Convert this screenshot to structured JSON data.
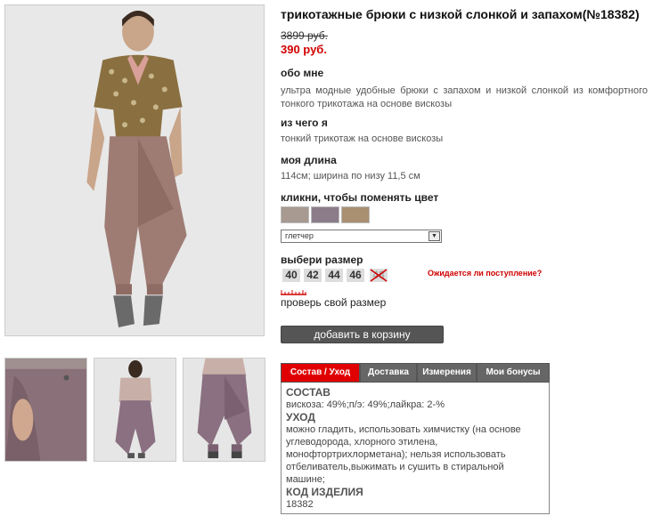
{
  "product": {
    "title": "трикотажные брюки с низкой слонкой и запахом(№18382)",
    "old_price": "3899 руб.",
    "new_price": "390 руб."
  },
  "sections": {
    "about_heading": "обо мне",
    "about_text": "ультра модные удобные брюки с запахом и низкой слонкой из комфортного тонкого трикотажа на основе вискозы",
    "material_heading": "из чего я",
    "material_text": "тонкий трикотаж на основе вискозы",
    "length_heading": "моя длина",
    "length_text": "114см; ширина по низу 11,5 см",
    "color_heading": "кликни, чтобы поменять цвет",
    "size_heading": "выбери размер"
  },
  "colors": {
    "swatches": [
      "#a89a90",
      "#8c7c8a",
      "#a89070"
    ],
    "selected": "глетчер"
  },
  "sizes": {
    "list": [
      "40",
      "42",
      "44",
      "46",
      "48"
    ],
    "unavailable": "48",
    "expect_link": "Ожидается ли поступление?"
  },
  "actions": {
    "check_size": "проверь свой размер",
    "add_to_cart": "добавить в корзину"
  },
  "tabs": {
    "items": [
      "Состав / Уход",
      "Доставка",
      "Измерения",
      "Мои бонусы"
    ],
    "active": "Состав / Уход"
  },
  "panel": {
    "composition_heading": "СОСТАВ",
    "composition_text": "вискоза: 49%;п/э: 49%;лайкра: 2-%",
    "care_heading": "УХОД",
    "care_text": "можно гладить, использовать химчистку (на основе углеводорода, хлорного этилена, монофтортрихлорметана); нельзя использовать отбеливатель,выжимать и сушить в стиральной машине;",
    "code_heading": "КОД ИЗДЕЛИЯ",
    "code_text": "18382"
  },
  "theme": {
    "accent": "#e00000",
    "price_color": "#d10000",
    "button_bg": "#555555"
  }
}
